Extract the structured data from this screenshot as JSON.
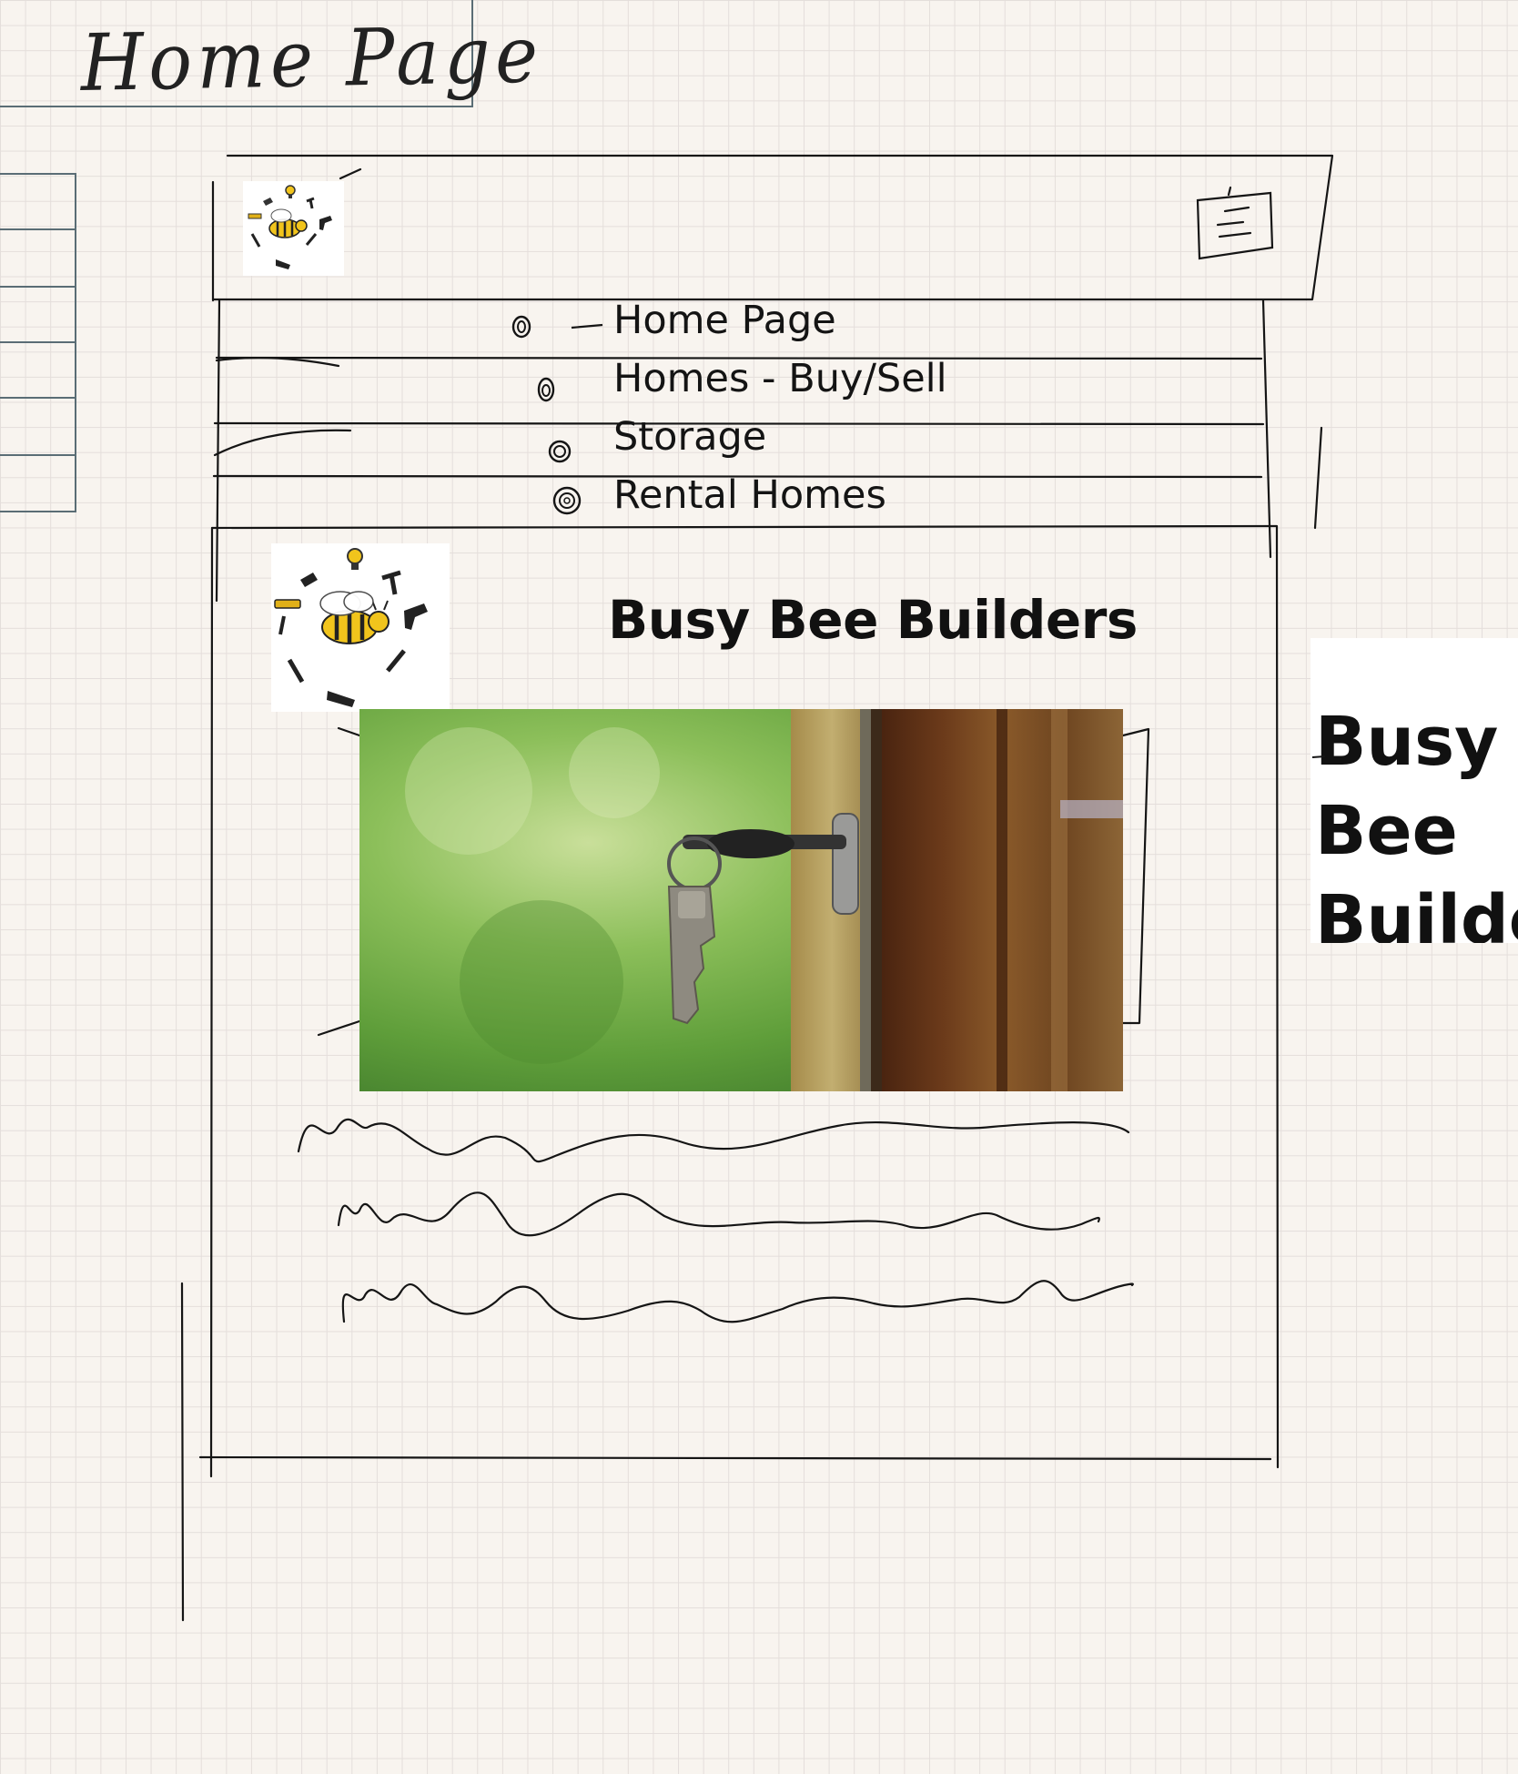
{
  "sketch_title": "Home Page",
  "nav": {
    "items": [
      {
        "label": "Home Page"
      },
      {
        "label": "Homes - Buy/Sell"
      },
      {
        "label": "Storage"
      },
      {
        "label": "Rental Homes"
      }
    ]
  },
  "header": {
    "logo_icon": "busy-bee-tools-logo",
    "menu_icon": "hamburger-menu-icon"
  },
  "main": {
    "heading": "Busy Bee Builders",
    "hero_image": "key-in-door-lock-photo",
    "placeholder_text_lines": 3
  },
  "side_card": {
    "text": "Busy Bee Builders"
  },
  "colors": {
    "paper": "#f8f4ef",
    "grid": "#e4dedb",
    "ink": "#151515",
    "side_lines": "#5a6d75",
    "bee_yellow": "#f1c41c"
  }
}
